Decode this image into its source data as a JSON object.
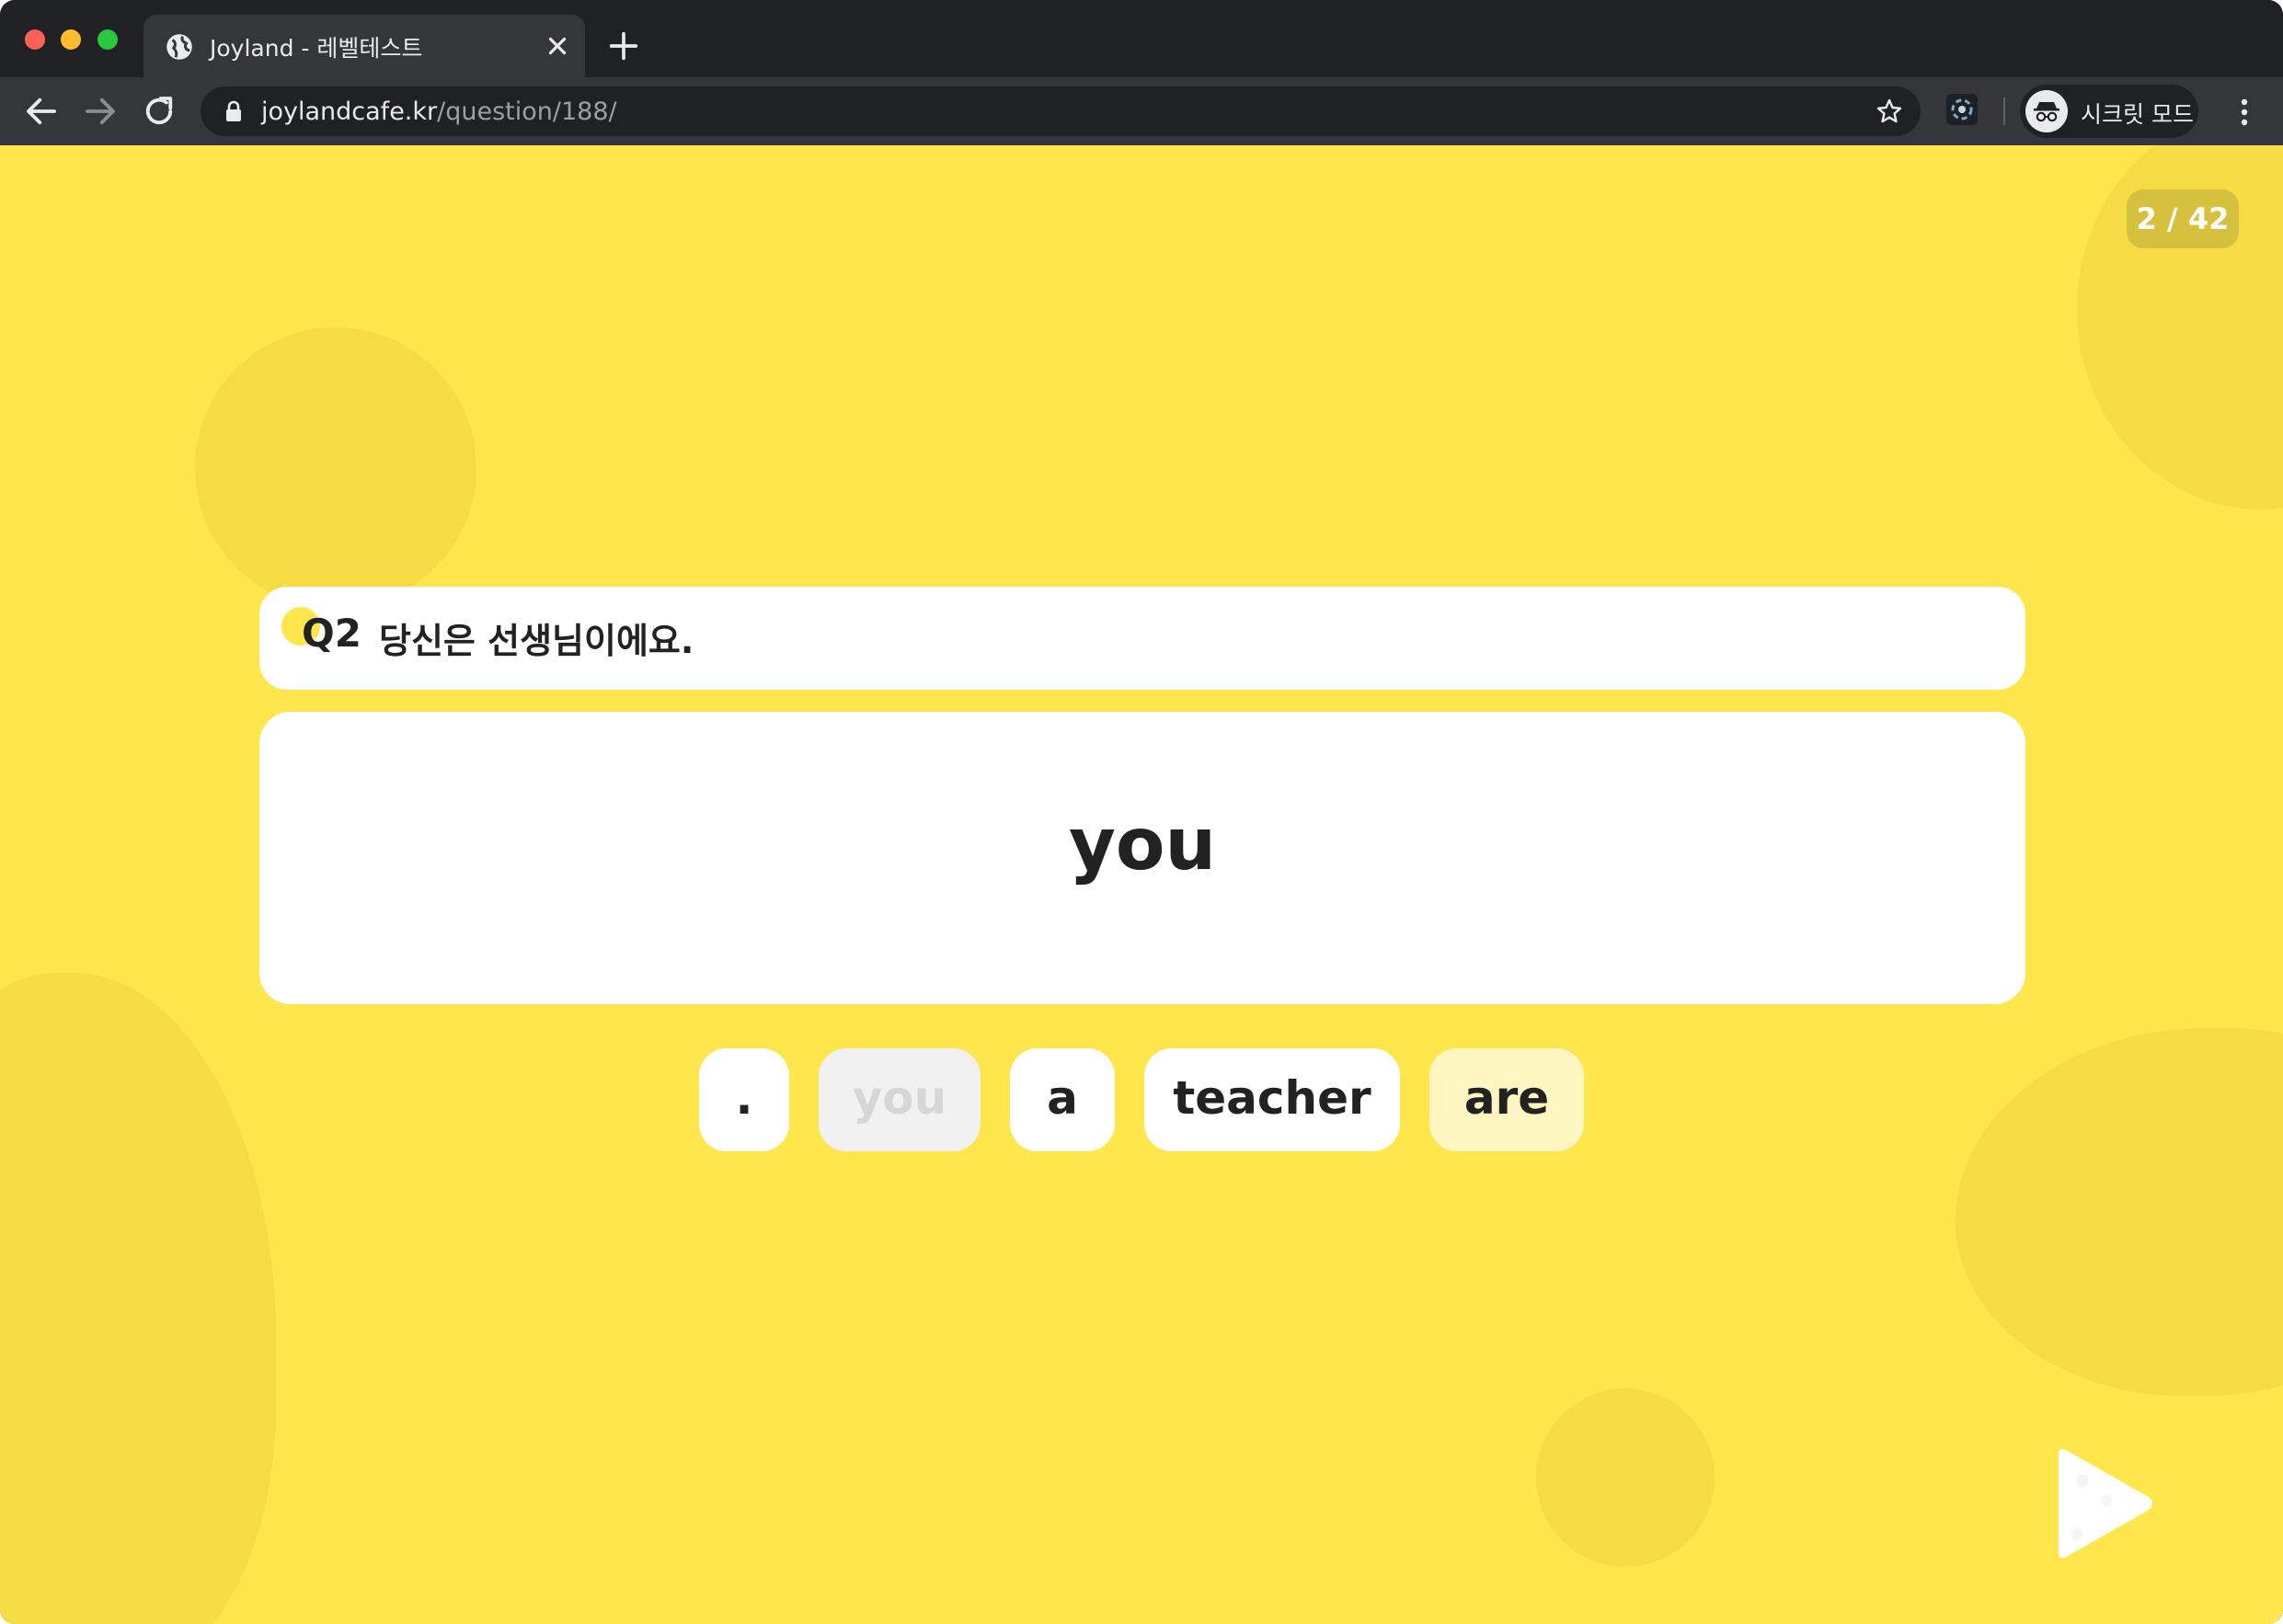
{
  "browser": {
    "tab_title": "Joyland - 레벨테스트",
    "url_host": "joylandcafe.kr",
    "url_path": "/question/188/",
    "profile_label": "시크릿 모드"
  },
  "quiz": {
    "progress": "2 / 42",
    "question_number": "Q2",
    "question_text": "당신은 선생님이에요.",
    "answer_text": "you",
    "choices": [
      {
        "label": ".",
        "state": "available"
      },
      {
        "label": "you",
        "state": "used"
      },
      {
        "label": "a",
        "state": "available"
      },
      {
        "label": "teacher",
        "state": "available"
      },
      {
        "label": "are",
        "state": "selected"
      }
    ]
  },
  "icons": {
    "tab": "globe-icon",
    "close": "close-icon",
    "new_tab": "plus-icon",
    "back": "arrow-left-icon",
    "forward": "arrow-right-icon",
    "reload": "reload-icon",
    "lock": "lock-icon",
    "bookmark": "star-icon",
    "extension": "extension-icon",
    "incognito": "incognito-icon",
    "menu": "kebab-menu-icon",
    "next": "play-icon"
  },
  "colors": {
    "page_background": "#ffe64d",
    "card_background": "#ffffff",
    "counter_background": "#d6c13f",
    "selected_chip": "#fff6c2",
    "used_chip": "#f1f1f1"
  }
}
